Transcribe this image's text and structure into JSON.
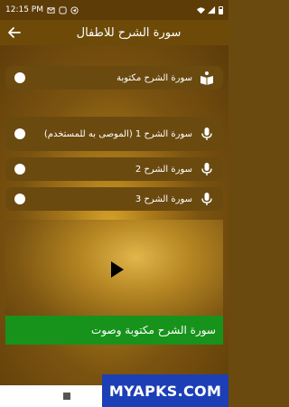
{
  "status_bar": {
    "time": "12:15 PM"
  },
  "app_bar": {
    "title": "سورة الشرح للاطفال"
  },
  "items": [
    {
      "label": "سورة الشرح مكتوبة",
      "icon": "open-book-icon"
    },
    {
      "label": "سورة الشرح 1 (الموصى به للمستخدم)",
      "icon": "microphone-icon"
    },
    {
      "label": "سورة الشرح 2",
      "icon": "microphone-icon"
    },
    {
      "label": "سورة الشرح 3",
      "icon": "microphone-icon"
    }
  ],
  "player": {
    "caption": "سورة الشرح مكتوبة وصوت"
  },
  "watermark": "MYAPKS.COM",
  "colors": {
    "accent": "#6e4a08",
    "caption_bg": "#17931c",
    "watermark_bg": "#1c3fb5"
  }
}
